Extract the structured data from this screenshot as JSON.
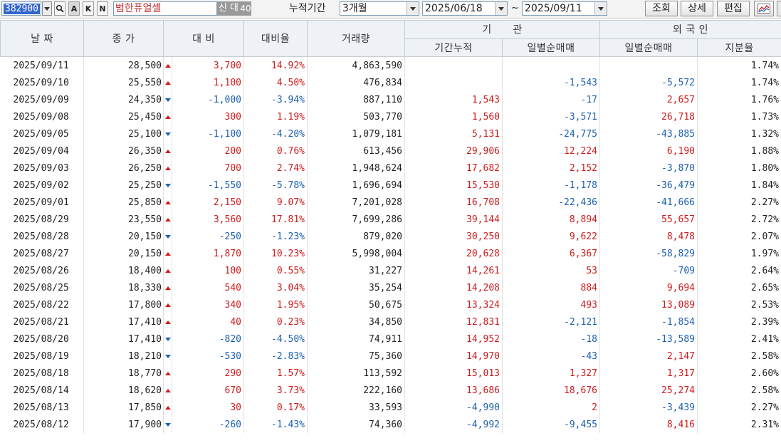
{
  "toolbar": {
    "code": "382900",
    "name": "범한퓨얼셀",
    "tag_new": "신",
    "tag_big": "대",
    "tag_num": "40",
    "small_btn_a": "A",
    "small_btn_k": "K",
    "small_btn_n": "N",
    "period_label": "누적기간",
    "period_value": "3개월",
    "date_from": "2025/06/18",
    "tilde": "~",
    "date_to": "2025/09/11",
    "btn_query": "조회",
    "btn_detail": "상세",
    "btn_edit": "편집"
  },
  "header": {
    "date": "날 짜",
    "close": "종 가",
    "diff": "대 비",
    "rate": "대비율",
    "volume": "거래량",
    "inst": "기      관",
    "inst_cum": "기간누적",
    "inst_daily": "일별순매매",
    "foreign": "외 국 인",
    "foreign_daily": "일별순매매",
    "foreign_share": "지분율"
  },
  "colors": {
    "up": "#d01c1c",
    "down": "#1c5fb0"
  },
  "rows": [
    {
      "date": "2025/09/11",
      "close": "28,500",
      "dir": "up",
      "diff": "3,700",
      "rate": "14.92%",
      "vol": "4,863,590",
      "icum": "",
      "icumd": "",
      "idaily": "",
      "idailyd": "",
      "fdaily": "",
      "fdailyd": "",
      "share": "1.74%"
    },
    {
      "date": "2025/09/10",
      "close": "25,550",
      "dir": "up",
      "diff": "1,100",
      "rate": "4.50%",
      "vol": "476,834",
      "icum": "",
      "icumd": "",
      "idaily": "-1,543",
      "idailyd": "down",
      "fdaily": "-5,572",
      "fdailyd": "down",
      "share": "1.74%"
    },
    {
      "date": "2025/09/09",
      "close": "24,350",
      "dir": "down",
      "diff": "-1,000",
      "rate": "-3.94%",
      "vol": "887,110",
      "icum": "1,543",
      "icumd": "up",
      "idaily": "-17",
      "idailyd": "down",
      "fdaily": "2,657",
      "fdailyd": "up",
      "share": "1.76%"
    },
    {
      "date": "2025/09/08",
      "close": "25,450",
      "dir": "up",
      "diff": "300",
      "rate": "1.19%",
      "vol": "503,770",
      "icum": "1,560",
      "icumd": "up",
      "idaily": "-3,571",
      "idailyd": "down",
      "fdaily": "26,718",
      "fdailyd": "up",
      "share": "1.73%"
    },
    {
      "date": "2025/09/05",
      "close": "25,100",
      "dir": "down",
      "diff": "-1,100",
      "rate": "-4.20%",
      "vol": "1,079,181",
      "icum": "5,131",
      "icumd": "up",
      "idaily": "-24,775",
      "idailyd": "down",
      "fdaily": "-43,885",
      "fdailyd": "down",
      "share": "1.32%"
    },
    {
      "date": "2025/09/04",
      "close": "26,350",
      "dir": "up",
      "diff": "200",
      "rate": "0.76%",
      "vol": "613,456",
      "icum": "29,906",
      "icumd": "up",
      "idaily": "12,224",
      "idailyd": "up",
      "fdaily": "6,190",
      "fdailyd": "up",
      "share": "1.88%"
    },
    {
      "date": "2025/09/03",
      "close": "26,250",
      "dir": "up",
      "diff": "700",
      "rate": "2.74%",
      "vol": "1,948,624",
      "icum": "17,682",
      "icumd": "up",
      "idaily": "2,152",
      "idailyd": "up",
      "fdaily": "-3,870",
      "fdailyd": "down",
      "share": "1.80%"
    },
    {
      "date": "2025/09/02",
      "close": "25,250",
      "dir": "down",
      "diff": "-1,550",
      "rate": "-5.78%",
      "vol": "1,696,694",
      "icum": "15,530",
      "icumd": "up",
      "idaily": "-1,178",
      "idailyd": "down",
      "fdaily": "-36,479",
      "fdailyd": "down",
      "share": "1.84%"
    },
    {
      "date": "2025/09/01",
      "close": "25,850",
      "dir": "up",
      "diff": "2,150",
      "rate": "9.07%",
      "vol": "7,201,028",
      "icum": "16,708",
      "icumd": "up",
      "idaily": "-22,436",
      "idailyd": "down",
      "fdaily": "-41,666",
      "fdailyd": "down",
      "share": "2.27%"
    },
    {
      "date": "2025/08/29",
      "close": "23,550",
      "dir": "up",
      "diff": "3,560",
      "rate": "17.81%",
      "vol": "7,699,286",
      "icum": "39,144",
      "icumd": "up",
      "idaily": "8,894",
      "idailyd": "up",
      "fdaily": "55,657",
      "fdailyd": "up",
      "share": "2.72%"
    },
    {
      "date": "2025/08/28",
      "close": "20,150",
      "dir": "down",
      "diff": "-250",
      "rate": "-1.23%",
      "vol": "879,020",
      "icum": "30,250",
      "icumd": "up",
      "idaily": "9,622",
      "idailyd": "up",
      "fdaily": "8,478",
      "fdailyd": "up",
      "share": "2.07%"
    },
    {
      "date": "2025/08/27",
      "close": "20,150",
      "dir": "up",
      "diff": "1,870",
      "rate": "10.23%",
      "vol": "5,998,004",
      "icum": "20,628",
      "icumd": "up",
      "idaily": "6,367",
      "idailyd": "up",
      "fdaily": "-58,829",
      "fdailyd": "down",
      "share": "1.97%"
    },
    {
      "date": "2025/08/26",
      "close": "18,400",
      "dir": "up",
      "diff": "100",
      "rate": "0.55%",
      "vol": "31,227",
      "icum": "14,261",
      "icumd": "up",
      "idaily": "53",
      "idailyd": "up",
      "fdaily": "-709",
      "fdailyd": "down",
      "share": "2.64%"
    },
    {
      "date": "2025/08/25",
      "close": "18,330",
      "dir": "up",
      "diff": "540",
      "rate": "3.04%",
      "vol": "35,254",
      "icum": "14,208",
      "icumd": "up",
      "idaily": "884",
      "idailyd": "up",
      "fdaily": "9,694",
      "fdailyd": "up",
      "share": "2.65%"
    },
    {
      "date": "2025/08/22",
      "close": "17,800",
      "dir": "up",
      "diff": "340",
      "rate": "1.95%",
      "vol": "50,675",
      "icum": "13,324",
      "icumd": "up",
      "idaily": "493",
      "idailyd": "up",
      "fdaily": "13,089",
      "fdailyd": "up",
      "share": "2.53%"
    },
    {
      "date": "2025/08/21",
      "close": "17,410",
      "dir": "up",
      "diff": "40",
      "rate": "0.23%",
      "vol": "34,850",
      "icum": "12,831",
      "icumd": "up",
      "idaily": "-2,121",
      "idailyd": "down",
      "fdaily": "-1,854",
      "fdailyd": "down",
      "share": "2.39%"
    },
    {
      "date": "2025/08/20",
      "close": "17,410",
      "dir": "down",
      "diff": "-820",
      "rate": "-4.50%",
      "vol": "74,911",
      "icum": "14,952",
      "icumd": "up",
      "idaily": "-18",
      "idailyd": "down",
      "fdaily": "-13,589",
      "fdailyd": "down",
      "share": "2.41%"
    },
    {
      "date": "2025/08/19",
      "close": "18,210",
      "dir": "down",
      "diff": "-530",
      "rate": "-2.83%",
      "vol": "75,360",
      "icum": "14,970",
      "icumd": "up",
      "idaily": "-43",
      "idailyd": "down",
      "fdaily": "2,147",
      "fdailyd": "up",
      "share": "2.58%"
    },
    {
      "date": "2025/08/18",
      "close": "18,770",
      "dir": "up",
      "diff": "290",
      "rate": "1.57%",
      "vol": "113,592",
      "icum": "15,013",
      "icumd": "up",
      "idaily": "1,327",
      "idailyd": "up",
      "fdaily": "1,317",
      "fdailyd": "up",
      "share": "2.60%"
    },
    {
      "date": "2025/08/14",
      "close": "18,620",
      "dir": "up",
      "diff": "670",
      "rate": "3.73%",
      "vol": "222,160",
      "icum": "13,686",
      "icumd": "up",
      "idaily": "18,676",
      "idailyd": "up",
      "fdaily": "25,274",
      "fdailyd": "up",
      "share": "2.58%"
    },
    {
      "date": "2025/08/13",
      "close": "17,850",
      "dir": "up",
      "diff": "30",
      "rate": "0.17%",
      "vol": "33,593",
      "icum": "-4,990",
      "icumd": "down",
      "idaily": "2",
      "idailyd": "up",
      "fdaily": "-3,439",
      "fdailyd": "down",
      "share": "2.27%"
    },
    {
      "date": "2025/08/12",
      "close": "17,900",
      "dir": "down",
      "diff": "-260",
      "rate": "-1.43%",
      "vol": "74,360",
      "icum": "-4,992",
      "icumd": "down",
      "idaily": "-9,455",
      "idailyd": "down",
      "fdaily": "8,416",
      "fdailyd": "up",
      "share": "2.31%"
    }
  ]
}
